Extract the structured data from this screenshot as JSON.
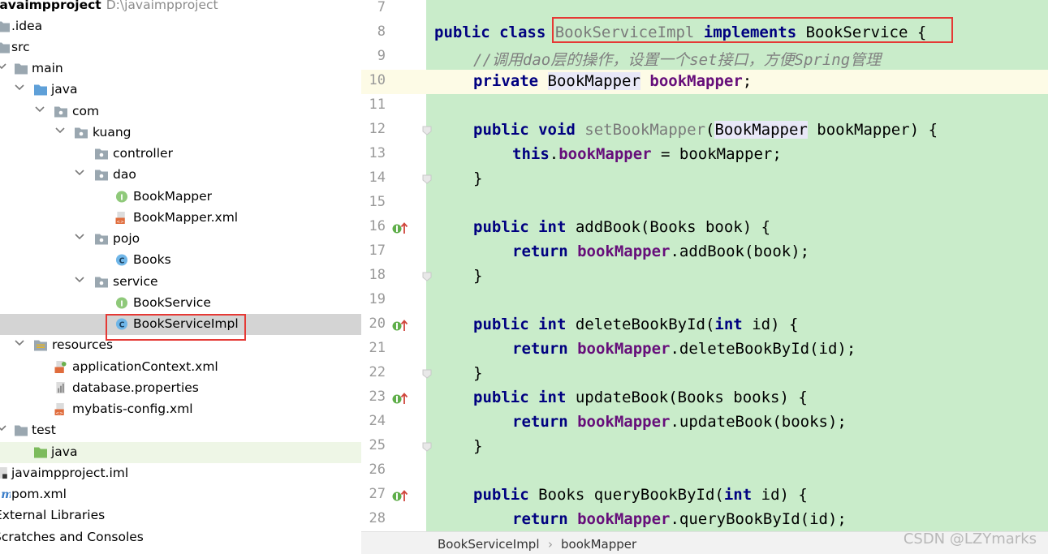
{
  "project_tree": {
    "root": {
      "label": "javaimpproject",
      "path": "D:\\javaimpproject"
    },
    "items": [
      {
        "label": ".idea"
      },
      {
        "label": "src"
      },
      {
        "label": "main"
      },
      {
        "label": "java"
      },
      {
        "label": "com"
      },
      {
        "label": "kuang"
      },
      {
        "label": "controller"
      },
      {
        "label": "dao"
      },
      {
        "label": "BookMapper"
      },
      {
        "label": "BookMapper.xml"
      },
      {
        "label": "pojo"
      },
      {
        "label": "Books"
      },
      {
        "label": "service"
      },
      {
        "label": "BookService"
      },
      {
        "label": "BookServiceImpl"
      },
      {
        "label": "resources"
      },
      {
        "label": "applicationContext.xml"
      },
      {
        "label": "database.properties"
      },
      {
        "label": "mybatis-config.xml"
      },
      {
        "label": "test"
      },
      {
        "label": "java"
      },
      {
        "label": "javaimpproject.iml"
      },
      {
        "label": "pom.xml"
      },
      {
        "label": "External Libraries"
      },
      {
        "label": "Scratches and Consoles"
      }
    ]
  },
  "editor": {
    "line_numbers": [
      "7",
      "8",
      "9",
      "10",
      "11",
      "12",
      "13",
      "14",
      "15",
      "16",
      "17",
      "18",
      "19",
      "20",
      "21",
      "22",
      "23",
      "24",
      "25",
      "26",
      "27",
      "28"
    ],
    "lines": [
      {
        "t": []
      },
      {
        "t": [
          "public class",
          " ",
          "BookServiceImpl",
          " ",
          "implements",
          " BookService {"
        ]
      },
      {
        "t": [
          "//调用dao层的操作，设置一个set接口，方便Spring管理"
        ]
      },
      {
        "t": [
          "private",
          " ",
          "BookMapper",
          " ",
          "bookMapper",
          ";"
        ]
      },
      {
        "t": []
      },
      {
        "t": [
          "public void",
          " ",
          "setBookMapper",
          "(",
          "BookMapper",
          " bookMapper) {"
        ]
      },
      {
        "t": [
          "this",
          ".",
          "bookMapper",
          " = bookMapper;"
        ]
      },
      {
        "t": [
          "}"
        ]
      },
      {
        "t": []
      },
      {
        "t": [
          "public int",
          " addBook(Books book) {"
        ]
      },
      {
        "t": [
          "return",
          " ",
          "bookMapper",
          ".addBook(book);"
        ]
      },
      {
        "t": [
          "}"
        ]
      },
      {
        "t": []
      },
      {
        "t": [
          "public int",
          " deleteBookById(",
          "int",
          " id) {"
        ]
      },
      {
        "t": [
          "return",
          " ",
          "bookMapper",
          ".deleteBookById(id);"
        ]
      },
      {
        "t": [
          "}"
        ]
      },
      {
        "t": [
          "public int",
          " updateBook(Books books) {"
        ]
      },
      {
        "t": [
          "return",
          " ",
          "bookMapper",
          ".updateBook(books);"
        ]
      },
      {
        "t": [
          "}"
        ]
      },
      {
        "t": []
      },
      {
        "t": [
          "public",
          " Books queryBookById(",
          "int",
          " id) {"
        ]
      },
      {
        "t": [
          "return",
          " ",
          "bookMapper",
          ".queryBookById(id);"
        ]
      }
    ]
  },
  "breadcrumb": {
    "items": [
      "BookServiceImpl",
      "bookMapper"
    ],
    "separator": "›"
  },
  "watermark": "CSDN @LZYmarks",
  "colors": {
    "editor_bg": "#c9ecca",
    "keyword": "#000080",
    "field": "#660e7a",
    "comment": "#808080",
    "highlight_box": "#e53935",
    "selected_row": "#d4d4d4"
  }
}
